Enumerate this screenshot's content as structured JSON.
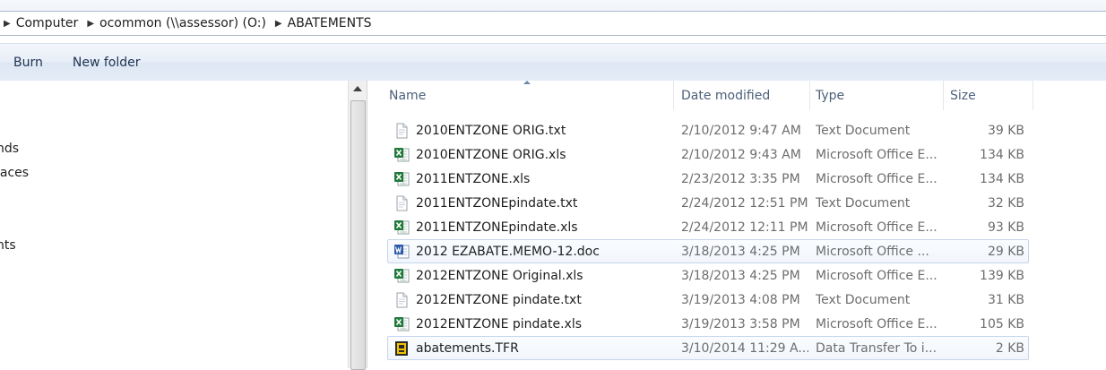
{
  "address": {
    "crumbs": [
      "Computer",
      "ocommon (\\\\assessor) (O:)",
      "ABATEMENTS"
    ]
  },
  "toolbar": {
    "burn_label": "Burn",
    "new_folder_label": "New folder"
  },
  "nav": {
    "items": [
      "nds",
      "laces",
      "nts"
    ]
  },
  "columns": {
    "name": "Name",
    "date": "Date modified",
    "type": "Type",
    "size": "Size"
  },
  "files": [
    {
      "name": "2010ENTZONE ORIG.txt",
      "date": "2/10/2012 9:47 AM",
      "type": "Text Document",
      "size": "39 KB",
      "icon": "text-document-icon"
    },
    {
      "name": "2010ENTZONE ORIG.xls",
      "date": "2/10/2012 9:43 AM",
      "type": "Microsoft Office E...",
      "size": "134 KB",
      "icon": "excel-icon"
    },
    {
      "name": "2011ENTZONE.xls",
      "date": "2/23/2012 3:35 PM",
      "type": "Microsoft Office E...",
      "size": "134 KB",
      "icon": "excel-icon"
    },
    {
      "name": "2011ENTZONEpindate.txt",
      "date": "2/24/2012 12:51 PM",
      "type": "Text Document",
      "size": "32 KB",
      "icon": "text-document-icon"
    },
    {
      "name": "2011ENTZONEpindate.xls",
      "date": "2/24/2012 12:11 PM",
      "type": "Microsoft Office E...",
      "size": "93 KB",
      "icon": "excel-icon"
    },
    {
      "name": "2012 EZABATE.MEMO-12.doc",
      "date": "3/18/2013 4:25 PM",
      "type": "Microsoft Office ...",
      "size": "29 KB",
      "icon": "word-icon"
    },
    {
      "name": "2012ENTZONE Original.xls",
      "date": "3/18/2013 4:25 PM",
      "type": "Microsoft Office E...",
      "size": "139 KB",
      "icon": "excel-icon"
    },
    {
      "name": "2012ENTZONE pindate.txt",
      "date": "3/19/2013 4:08 PM",
      "type": "Text Document",
      "size": "31 KB",
      "icon": "text-document-icon"
    },
    {
      "name": "2012ENTZONE pindate.xls",
      "date": "3/19/2013 3:58 PM",
      "type": "Microsoft Office E...",
      "size": "105 KB",
      "icon": "excel-icon"
    },
    {
      "name": "abatements.TFR",
      "date": "3/10/2014 11:29 A...",
      "type": "Data Transfer To i...",
      "size": "2 KB",
      "icon": "data-transfer-icon"
    }
  ],
  "colors": {
    "highlight": "#f6f63a",
    "excel_green": "#1f7a3a",
    "word_blue": "#2b5aa8"
  }
}
